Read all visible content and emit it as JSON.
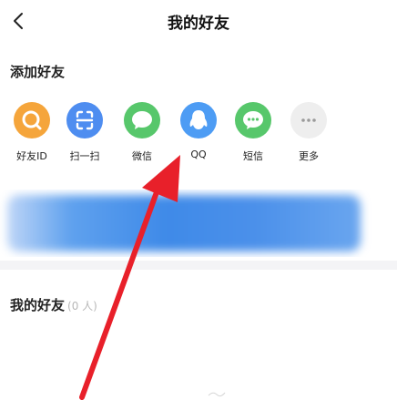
{
  "header": {
    "title": "我的好友"
  },
  "add_section": {
    "title": "添加好友"
  },
  "add_options": [
    {
      "label": "好友ID",
      "color": "#f5a53b",
      "icon": "search-icon"
    },
    {
      "label": "扫一扫",
      "color": "#4e8df0",
      "icon": "scan-icon"
    },
    {
      "label": "微信",
      "color": "#57c76b",
      "icon": "wechat-icon"
    },
    {
      "label": "QQ",
      "color": "#4d9cf4",
      "icon": "qq-icon"
    },
    {
      "label": "短信",
      "color": "#57c76b",
      "icon": "sms-icon"
    },
    {
      "label": "更多",
      "color": "#eeeeee",
      "icon": "more-icon"
    }
  ],
  "friends_section": {
    "title": "我的好友",
    "count": "(0 人)"
  },
  "colors": {
    "annotation_arrow": "#e8202a",
    "divider": "#f4f4f6"
  }
}
